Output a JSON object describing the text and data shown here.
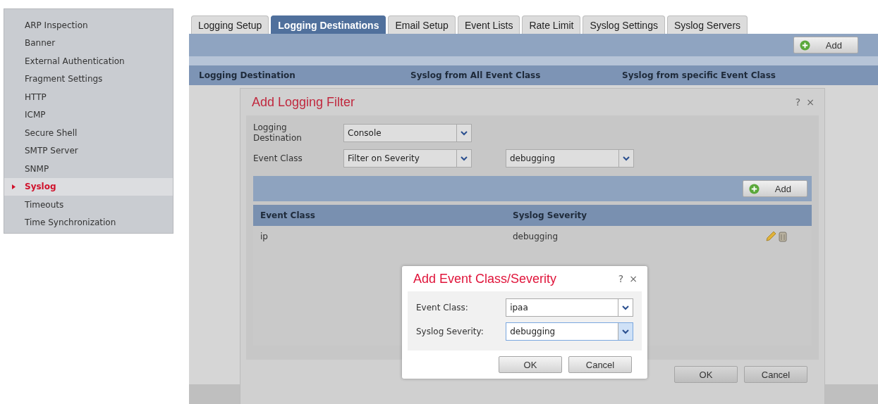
{
  "sidebar": {
    "items": [
      {
        "label": "ARP Inspection",
        "selected": false
      },
      {
        "label": "Banner",
        "selected": false
      },
      {
        "label": "External Authentication",
        "selected": false
      },
      {
        "label": "Fragment Settings",
        "selected": false
      },
      {
        "label": "HTTP",
        "selected": false
      },
      {
        "label": "ICMP",
        "selected": false
      },
      {
        "label": "Secure Shell",
        "selected": false
      },
      {
        "label": "SMTP Server",
        "selected": false
      },
      {
        "label": "SNMP",
        "selected": false
      },
      {
        "label": "Syslog",
        "selected": true
      },
      {
        "label": "Timeouts",
        "selected": false
      },
      {
        "label": "Time Synchronization",
        "selected": false
      }
    ]
  },
  "tabs": [
    {
      "label": "Logging Setup",
      "selected": false
    },
    {
      "label": "Logging Destinations",
      "selected": true
    },
    {
      "label": "Email Setup",
      "selected": false
    },
    {
      "label": "Event Lists",
      "selected": false
    },
    {
      "label": "Rate Limit",
      "selected": false
    },
    {
      "label": "Syslog Settings",
      "selected": false
    },
    {
      "label": "Syslog Servers",
      "selected": false
    }
  ],
  "toolbar": {
    "add_button": "Add"
  },
  "table": {
    "columns": [
      "Logging Destination",
      "Syslog from All Event Class",
      "Syslog from specific Event Class"
    ]
  },
  "dialog": {
    "title": "Add Logging Filter",
    "help": "?",
    "close": "×",
    "fields": [
      {
        "label": "Logging Destination",
        "value": "Console"
      },
      {
        "label": "Event Class",
        "value": "Filter on Severity",
        "extra_value": "debugging"
      }
    ],
    "toolbar": {
      "add_button": "Add"
    },
    "table": {
      "columns": [
        "Event Class",
        "Syslog Severity"
      ],
      "rows": [
        {
          "event_class": "ip",
          "severity": "debugging"
        }
      ]
    },
    "buttons": [
      "OK",
      "Cancel"
    ]
  },
  "subdialog": {
    "title": "Add Event Class/Severity",
    "help": "?",
    "close": "×",
    "fields": [
      {
        "label": "Event Class:",
        "value": "ipaa",
        "focused": false
      },
      {
        "label": "Syslog Severity:",
        "value": "debugging",
        "focused": true
      }
    ],
    "buttons": [
      "OK",
      "Cancel"
    ]
  }
}
